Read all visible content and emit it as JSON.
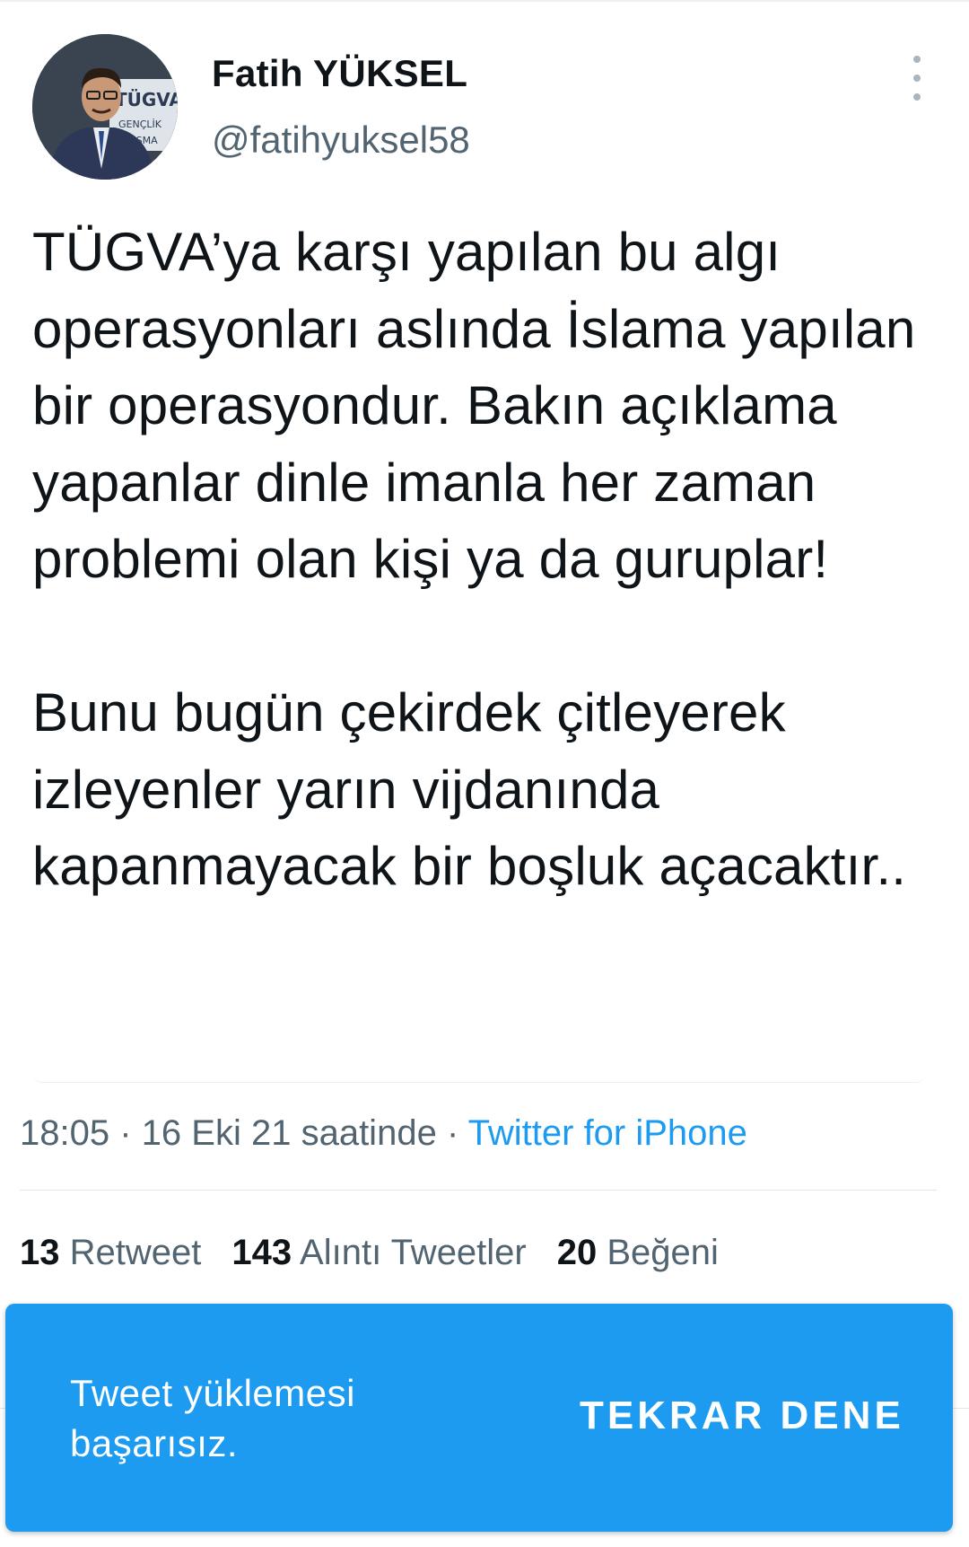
{
  "author": {
    "display_name": "Fatih YÜKSEL",
    "handle": "@fatihyuksel58",
    "avatar_icon": "profile-photo",
    "avatar_lettering": "TÜGVA GENÇLİK BULUŞMASI"
  },
  "tweet": {
    "text": "TÜGVA’ya karşı yapılan bu algı operasyonları aslında İslama yapılan bir operasyondur. Bakın açıklama yapanlar dinle imanla her zaman problemi olan kişi ya da guruplar!\n\nBunu bugün çekirdek çitleyerek izleyenler yarın vijdanında kapanmayacak bir boşluk açacaktır..",
    "time": "18:05",
    "separator": "·",
    "date": "16 Eki 21 saatinde",
    "source": "Twitter for iPhone"
  },
  "stats": {
    "retweets_count": "13",
    "retweets_label": "Retweet",
    "quotes_count": "143",
    "quotes_label": "Alıntı Tweetler",
    "likes_count": "20",
    "likes_label": "Beğeni"
  },
  "snackbar": {
    "message": "Tweet yüklemesi\nbaşarısız.",
    "action_label": "TEKRAR DENE"
  },
  "colors": {
    "accent": "#1d9bf0",
    "text_primary": "#0f1419",
    "text_secondary": "#536471",
    "snackbar_bg": "#1d9bf0"
  },
  "icons": {
    "more": "more-vertical-icon"
  }
}
